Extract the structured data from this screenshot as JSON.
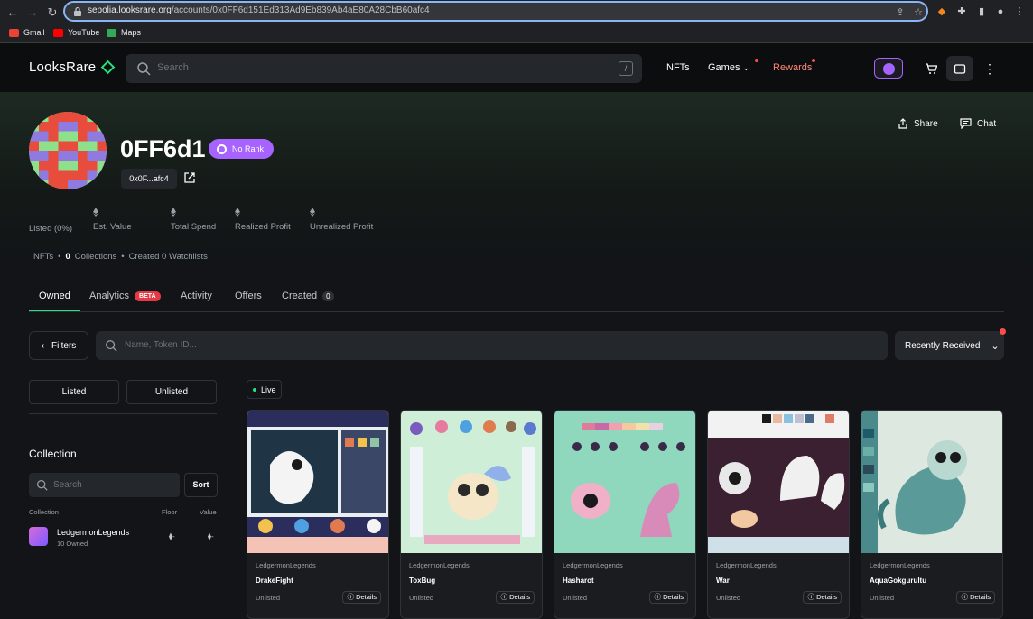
{
  "browser": {
    "url_host": "sepolia.looksrare.org",
    "url_path": "/accounts/0x0FF6d151Ed313Ad9Eb839Ab4aE80A28CbB60afc4",
    "bookmarks": [
      "Gmail",
      "YouTube",
      "Maps"
    ]
  },
  "header": {
    "logo": "LooksRare",
    "search_placeholder": "Search",
    "search_shortcut": "/",
    "nav": {
      "nfts": "NFTs",
      "games": "Games",
      "rewards": "Rewards"
    }
  },
  "profile": {
    "username": "0FF6d1",
    "rank": "No Rank",
    "address_short": "0x0F...afc4",
    "share": "Share",
    "chat": "Chat",
    "stats": {
      "listed": "Listed (0%)",
      "est_value": "Est. Value",
      "total_spend": "Total Spend",
      "realized_profit": "Realized Profit",
      "unrealized_profit": "Unrealized Profit"
    },
    "counts": {
      "nfts_label": "NFTs",
      "collections_count": "0",
      "collections_label": "Collections",
      "created_label": "Created 0 Watchlists"
    }
  },
  "tabs": {
    "owned": "Owned",
    "analytics": "Analytics",
    "beta": "BETA",
    "activity": "Activity",
    "offers": "Offers",
    "created": "Created",
    "created_count": "0"
  },
  "toolbar": {
    "filters": "Filters",
    "search_placeholder": "Name, Token ID...",
    "sort": "Recently Received"
  },
  "sidebar": {
    "listed": "Listed",
    "unlisted": "Unlisted",
    "collection_title": "Collection",
    "search_placeholder": "Search",
    "sort_btn": "Sort",
    "col_collection": "Collection",
    "col_floor": "Floor",
    "col_value": "Value",
    "row": {
      "name": "LedgermonLegends",
      "owned": "10 Owned",
      "floor": "-",
      "value": "-"
    }
  },
  "live": "Live",
  "cards": [
    {
      "collection": "LedgermonLegends",
      "name": "DrakeFight",
      "status": "Unlisted",
      "details": "Details"
    },
    {
      "collection": "LedgermonLegends",
      "name": "ToxBug",
      "status": "Unlisted",
      "details": "Details"
    },
    {
      "collection": "LedgermonLegends",
      "name": "Hasharot",
      "status": "Unlisted",
      "details": "Details"
    },
    {
      "collection": "LedgermonLegends",
      "name": "War",
      "status": "Unlisted",
      "details": "Details"
    },
    {
      "collection": "LedgermonLegends",
      "name": "AquaGokgurultu",
      "status": "Unlisted",
      "details": "Details"
    }
  ],
  "colors": {
    "accent_green": "#27e07c",
    "purple": "#a663ff",
    "rewards": "#ff8a7a",
    "alert": "#ff4d4d"
  }
}
